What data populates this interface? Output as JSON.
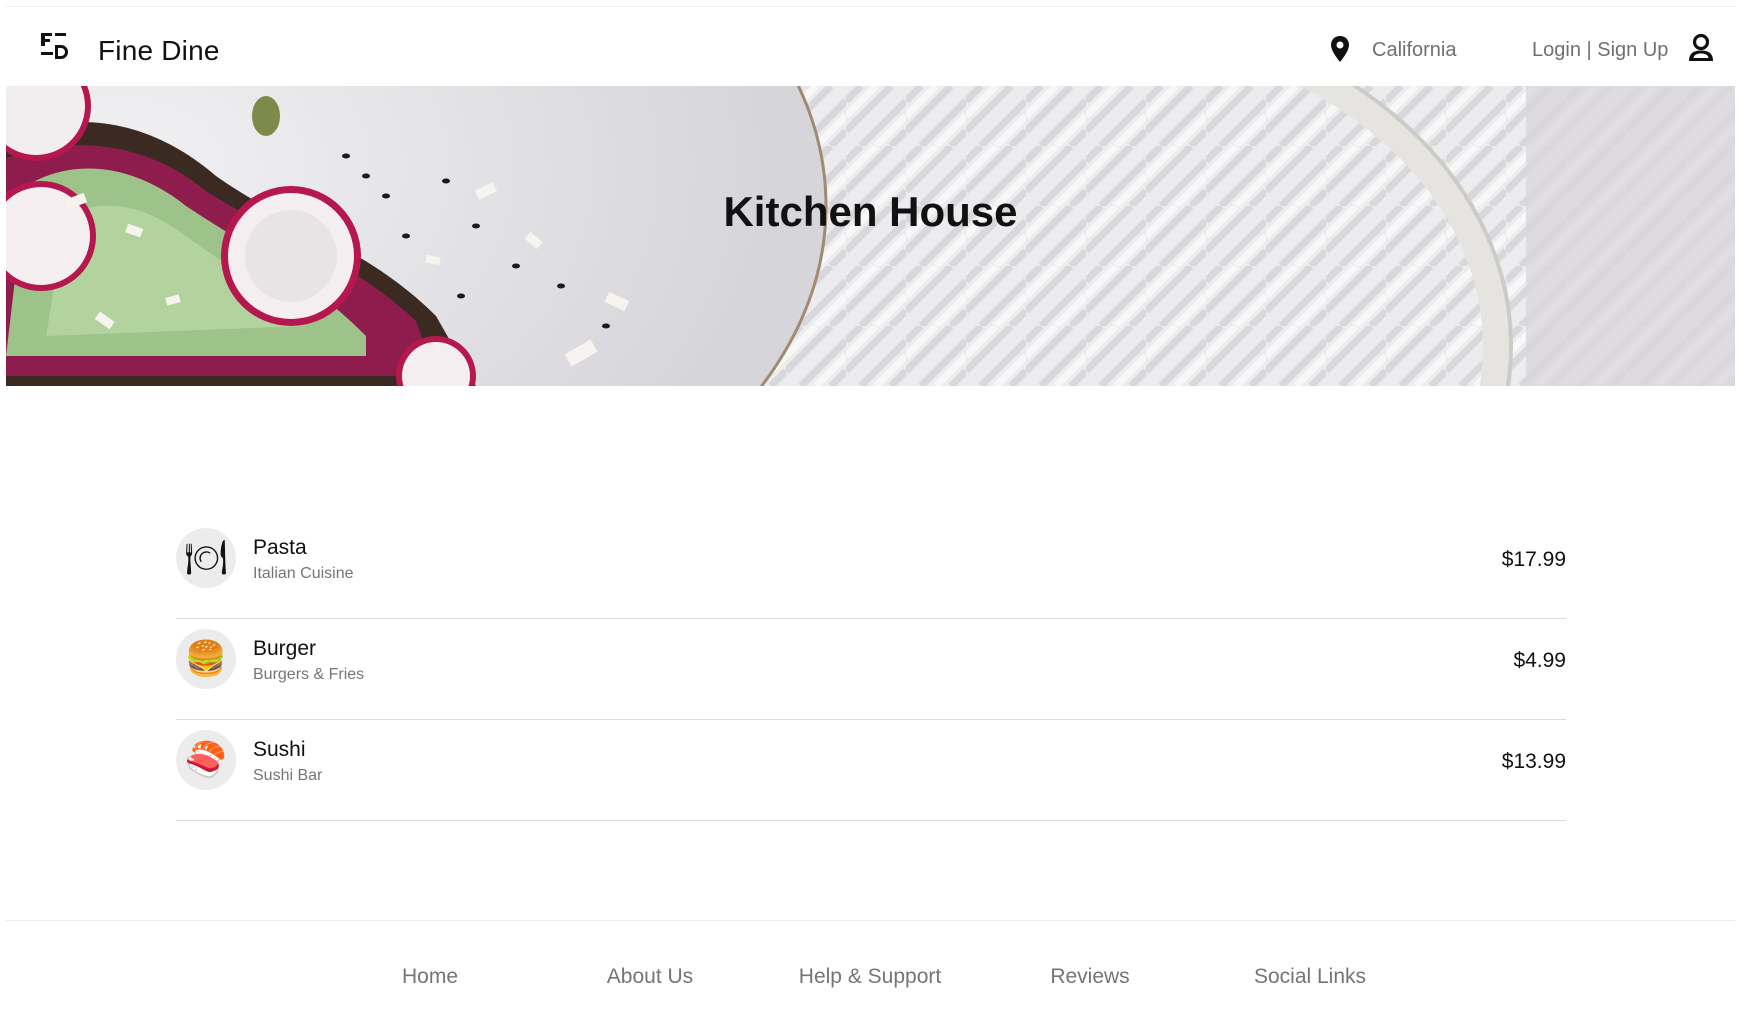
{
  "header": {
    "brand": "Fine Dine",
    "location": "California",
    "auth_label": "Login | Sign Up"
  },
  "hero": {
    "title": "Kitchen House"
  },
  "menu": {
    "items": [
      {
        "name": "Pasta",
        "category": "Italian Cuisine",
        "price": "$17.99",
        "icon": "plate-icon"
      },
      {
        "name": "Burger",
        "category": "Burgers & Fries",
        "price": "$4.99",
        "icon": "burger-icon"
      },
      {
        "name": "Sushi",
        "category": "Sushi Bar",
        "price": "$13.99",
        "icon": "sushi-icon"
      }
    ]
  },
  "footer": {
    "links": [
      "Home",
      "About Us",
      "Help & Support",
      "Reviews",
      "Social Links"
    ]
  },
  "colors": {
    "text": "#111111",
    "muted": "#757575",
    "divider": "#dcdcdc"
  }
}
